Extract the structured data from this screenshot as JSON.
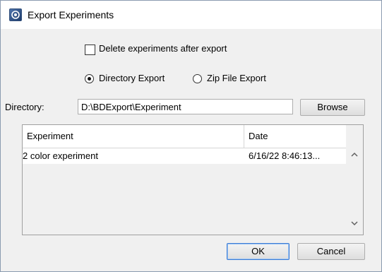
{
  "window": {
    "title": "Export Experiments",
    "icon": "app-window-icon"
  },
  "options": {
    "delete_after_export": {
      "label": "Delete experiments after export",
      "checked": false
    },
    "export_mode": {
      "selected": "directory",
      "directory_label": "Directory Export",
      "zip_label": "Zip File Export"
    }
  },
  "directory": {
    "label": "Directory:",
    "value": "D:\\BDExport\\Experiment",
    "browse_label": "Browse"
  },
  "table": {
    "columns": [
      "Experiment",
      "Date"
    ],
    "rows": [
      [
        "2 color experiment",
        "6/16/22 8:46:13..."
      ]
    ]
  },
  "buttons": {
    "ok_label": "OK",
    "cancel_label": "Cancel"
  },
  "colors": {
    "dialog_bg": "#f0f0f0",
    "default_button_border": "#3d7bd3"
  }
}
